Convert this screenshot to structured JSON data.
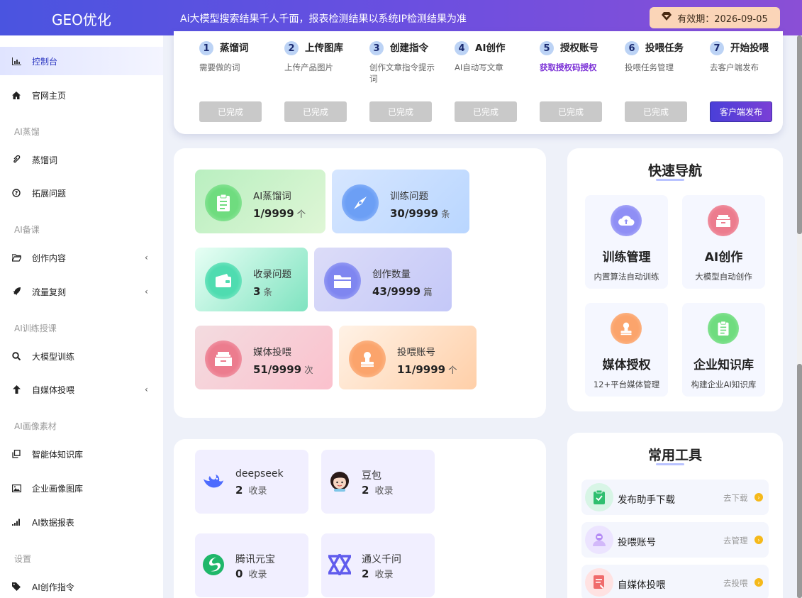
{
  "header": {
    "logo": "GEO优化",
    "notice": "Ai大模型搜索结果千人千面，报表检测结果以系统IP检测结果为准",
    "validity": "有效期：2026-09-05"
  },
  "sidebar": {
    "items": [
      {
        "label": "控制台",
        "icon": "bar-chart-icon"
      },
      {
        "label": "官网主页",
        "icon": "home-icon"
      },
      {
        "label": "蒸馏词",
        "icon": "paperclip-icon"
      },
      {
        "label": "拓展问题",
        "icon": "question-circle-icon"
      },
      {
        "label": "创作内容",
        "icon": "folder-open-icon"
      },
      {
        "label": "流量复刻",
        "icon": "rocket-icon"
      },
      {
        "label": "大模型训练",
        "icon": "search-icon"
      },
      {
        "label": "自媒体投喂",
        "icon": "arrow-up-icon"
      },
      {
        "label": "智能体知识库",
        "icon": "copy-icon"
      },
      {
        "label": "企业画像图库",
        "icon": "image-icon"
      },
      {
        "label": "AI数据报表",
        "icon": "signal-icon"
      },
      {
        "label": "AI创作指令",
        "icon": "tag-icon"
      }
    ],
    "groups": [
      "AI蒸馏",
      "AI备课",
      "AI训练授课",
      "AI画像素材",
      "设置"
    ]
  },
  "steps": [
    {
      "num": "1",
      "title": "蒸馏词",
      "sub": "需要做的词",
      "button": "已完成"
    },
    {
      "num": "2",
      "title": "上传图库",
      "sub": "上传产品图片",
      "button": "已完成"
    },
    {
      "num": "3",
      "title": "创建指令",
      "sub": "创作文章指令提示词",
      "button": "已完成"
    },
    {
      "num": "4",
      "title": "AI创作",
      "sub": "AI自动写文章",
      "button": "已完成"
    },
    {
      "num": "5",
      "title": "授权账号",
      "sub": "获取授权码授权",
      "button": "已完成"
    },
    {
      "num": "6",
      "title": "投喂任务",
      "sub": "投喂任务管理",
      "button": "已完成"
    },
    {
      "num": "7",
      "title": "开始投喂",
      "sub": "去客户端发布",
      "button": "客户端发布"
    }
  ],
  "stats": [
    {
      "label": "AI蒸馏词",
      "value": "1/9999",
      "unit": "个"
    },
    {
      "label": "训练问题",
      "value": "30/9999",
      "unit": "条"
    },
    {
      "label": "收录问题",
      "value": "3",
      "unit": "条"
    },
    {
      "label": "创作数量",
      "value": "43/9999",
      "unit": "篇"
    },
    {
      "label": "媒体投喂",
      "value": "51/9999",
      "unit": "次"
    },
    {
      "label": "投喂账号",
      "value": "11/9999",
      "unit": "个"
    }
  ],
  "quick_nav": {
    "title": "快速导航",
    "items": [
      {
        "name": "训练管理",
        "desc": "内置算法自动训练"
      },
      {
        "name": "AI创作",
        "desc": "大模型自动创作"
      },
      {
        "name": "媒体授权",
        "desc": "12+平台媒体管理"
      },
      {
        "name": "企业知识库",
        "desc": "构建企业AI知识库"
      }
    ]
  },
  "models": [
    {
      "name": "deepseek",
      "count": "2",
      "unit": "收录"
    },
    {
      "name": "豆包",
      "count": "2",
      "unit": "收录"
    },
    {
      "name": "腾讯元宝",
      "count": "0",
      "unit": "收录"
    },
    {
      "name": "通义千问",
      "count": "2",
      "unit": "收录"
    }
  ],
  "tools": {
    "title": "常用工具",
    "items": [
      {
        "name": "发布助手下载",
        "action": "去下载"
      },
      {
        "name": "投喂账号",
        "action": "去管理"
      },
      {
        "name": "自媒体投喂",
        "action": "去投喂"
      }
    ]
  },
  "colors": {
    "accent": "#4a54e0",
    "brand_purple": "#7a3fd6",
    "validity_bg": "#fbd5b8"
  }
}
